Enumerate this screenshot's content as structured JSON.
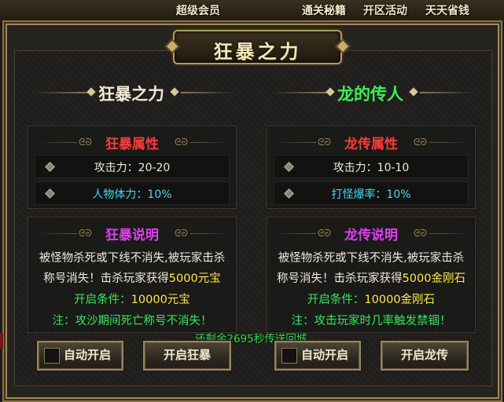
{
  "top_menu": [
    "超级会员",
    "通关秘籍",
    "开区活动",
    "天天省钱"
  ],
  "title": "狂暴之力",
  "colors": {
    "red_title": "#ff3b3b",
    "magenta_title": "#e23df2",
    "cyan_text": "#46d6f2",
    "green_text": "#36e85a",
    "yellow_text": "#ffe84a",
    "green_header": "#3cf058"
  },
  "left": {
    "header": "狂暴之力",
    "attr_title": "狂暴属性",
    "stat1": "攻击力：20-20",
    "stat2": "人物体力：10%",
    "desc_title": "狂暴说明",
    "desc_line1": "被怪物杀死或下线不消失,被玩家击杀",
    "desc_line2a": "称号消失！击杀玩家获得",
    "desc_line2b": "5000元宝",
    "cond_label": "开启条件：",
    "cond_value": "10000元宝",
    "note": "注：攻沙期间死亡称号不消失！",
    "auto_button": "自动开启",
    "open_button": "开启狂暴"
  },
  "right": {
    "header": "龙的传人",
    "attr_title": "龙传属性",
    "stat1": "攻击力：10-10",
    "stat2": "打怪爆率：10%",
    "desc_title": "龙传说明",
    "desc_line1": "被怪物杀死或下线不消失,被玩家击杀",
    "desc_line2a": "称号消失！击杀玩家获得",
    "desc_line2b": "5000金刚石",
    "cond_label": "开启条件：",
    "cond_value": "10000金刚石",
    "note": "注：攻击玩家时几率触发禁锢！",
    "auto_button": "自动开启",
    "open_button": "开启龙传"
  },
  "overlay_message": "还剩余2695秒传送回城."
}
